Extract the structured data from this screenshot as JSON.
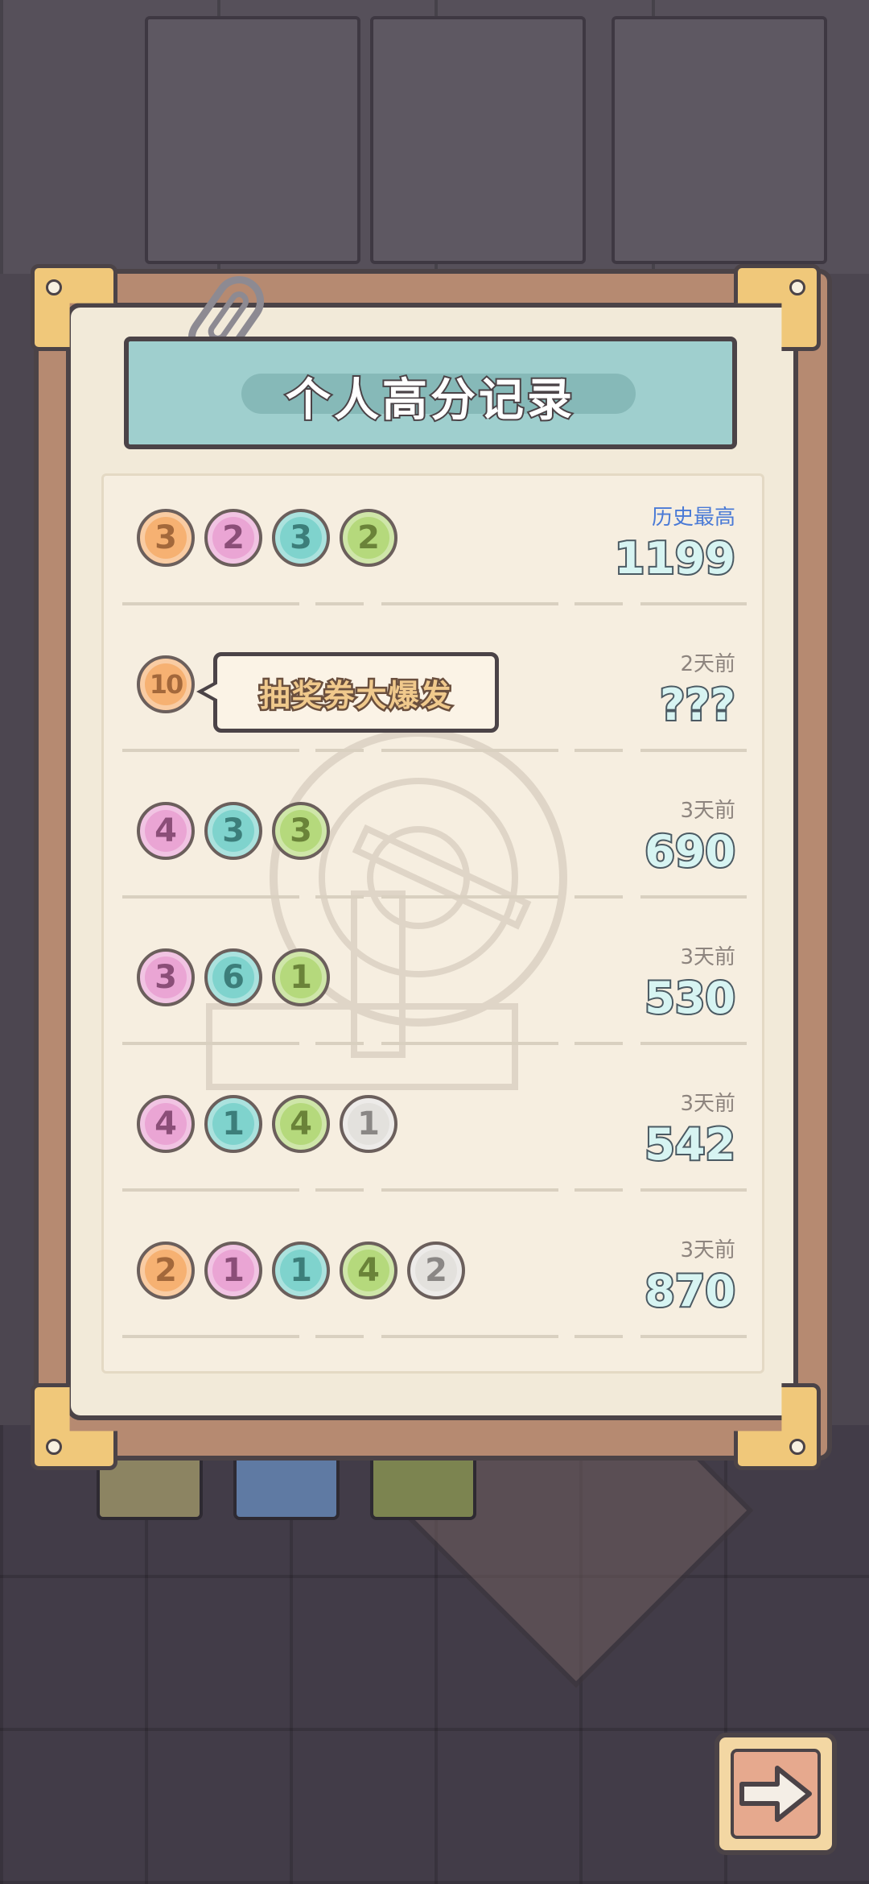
{
  "title": "个人高分记录",
  "records": [
    {
      "time": "历史最高",
      "score": "1199",
      "balls": [
        {
          "value": "3",
          "color": "orange"
        },
        {
          "value": "2",
          "color": "pink"
        },
        {
          "value": "3",
          "color": "teal"
        },
        {
          "value": "2",
          "color": "green"
        }
      ]
    },
    {
      "time": "2天前",
      "score": "???",
      "balls": [
        {
          "value": "10",
          "color": "orange"
        }
      ]
    },
    {
      "time": "3天前",
      "score": "690",
      "balls": [
        {
          "value": "4",
          "color": "pink"
        },
        {
          "value": "3",
          "color": "teal"
        },
        {
          "value": "3",
          "color": "green"
        }
      ]
    },
    {
      "time": "3天前",
      "score": "530",
      "balls": [
        {
          "value": "3",
          "color": "pink"
        },
        {
          "value": "6",
          "color": "teal"
        },
        {
          "value": "1",
          "color": "green"
        }
      ]
    },
    {
      "time": "3天前",
      "score": "542",
      "balls": [
        {
          "value": "4",
          "color": "pink"
        },
        {
          "value": "1",
          "color": "teal"
        },
        {
          "value": "4",
          "color": "green"
        },
        {
          "value": "1",
          "color": "silver"
        }
      ]
    },
    {
      "time": "3天前",
      "score": "870",
      "balls": [
        {
          "value": "2",
          "color": "orange"
        },
        {
          "value": "1",
          "color": "pink"
        },
        {
          "value": "1",
          "color": "teal"
        },
        {
          "value": "4",
          "color": "green"
        },
        {
          "value": "2",
          "color": "silver"
        }
      ]
    }
  ],
  "tooltip": "抽奖券大爆发",
  "icons": {
    "next": "arrow-right-icon",
    "clip": "paperclip-icon",
    "machine": "lottery-machine-icon"
  },
  "colors": {
    "best_label": "#4a7ad6",
    "banner": "#9fcfce",
    "frame": "#b68a71"
  }
}
